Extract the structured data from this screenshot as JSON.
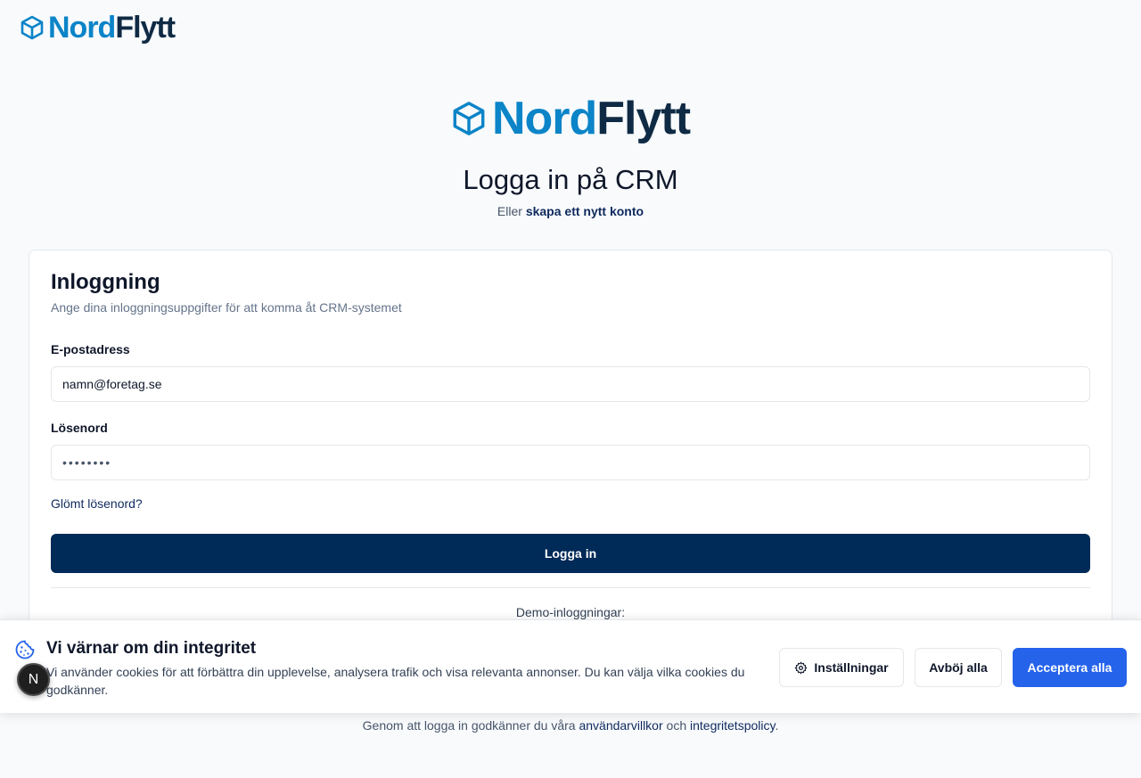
{
  "brand": {
    "part1": "Nord",
    "part2": "Flytt",
    "accent": "#0b84c8",
    "dark": "#0f2a44"
  },
  "page": {
    "title": "Logga in på CRM",
    "subtitle_prefix": "Eller",
    "create_account_link": "skapa ett nytt konto"
  },
  "card": {
    "title": "Inloggning",
    "description": "Ange dina inloggningsuppgifter för att komma åt CRM-systemet",
    "email_label": "E-postadress",
    "email_value": "namn@foretag.se",
    "password_label": "Lösenord",
    "password_value": "••••••••",
    "forgot_link": "Glömt lösenord?",
    "login_button": "Logga in",
    "demo_title": "Demo-inloggningar:"
  },
  "footer": {
    "prefix": "Genom att logga in godkänner du våra",
    "terms_link": "användarvillkor",
    "and": "och",
    "privacy_link": "integritetspolicy",
    "suffix": "."
  },
  "cookie_banner": {
    "title": "Vi värnar om din integritet",
    "text": "Vi använder cookies för att förbättra din upplevelse, analysera trafik och visa relevanta annonser. Du kan välja vilka cookies du godkänner.",
    "settings_button": "Inställningar",
    "reject_button": "Avböj alla",
    "accept_button": "Acceptera alla",
    "accept_color": "#2563eb"
  },
  "dev_badge": {
    "label": "N"
  },
  "icons": [
    "cube-icon",
    "cookie-icon",
    "gear-icon"
  ]
}
